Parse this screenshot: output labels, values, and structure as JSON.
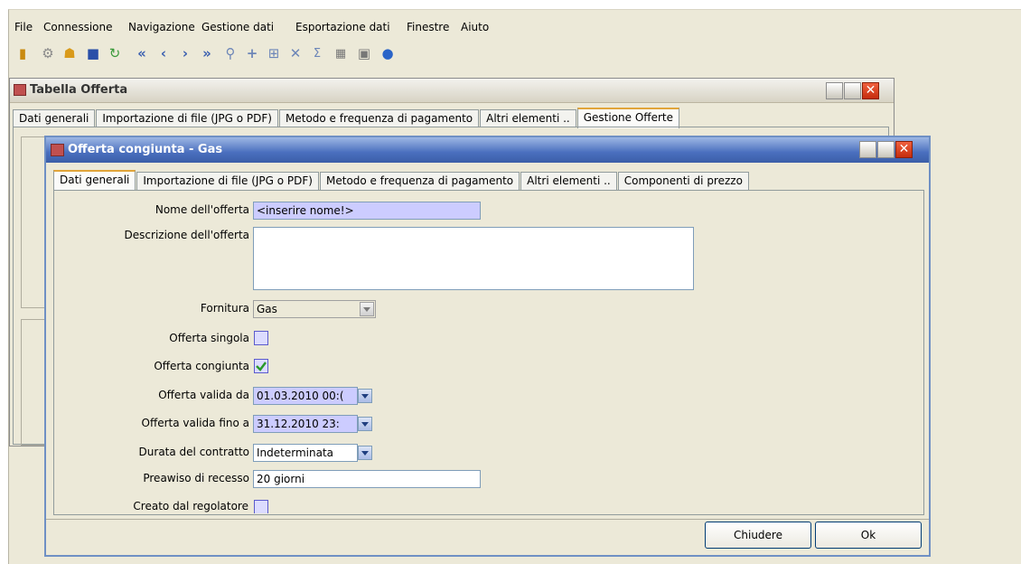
{
  "menu": [
    "File",
    "Connessione",
    "Navigazione",
    "Gestione dati",
    "Esportazione dati",
    "Finestre",
    "Aiuto"
  ],
  "toolbar": {
    "icons": [
      "exit-icon",
      "connect-icon",
      "user-key-icon",
      "save-icon",
      "refresh-icon",
      "first-record-icon",
      "previous-record-icon",
      "next-record-icon",
      "last-record-icon",
      "search-icon",
      "add-icon",
      "tree-icon",
      "delete-icon",
      "sum-icon",
      "calendar-icon",
      "export-icon",
      "help-icon"
    ]
  },
  "back_window": {
    "title": "Tabella Offerta",
    "tabs": [
      "Dati generali",
      "Importazione di file (JPG o PDF)",
      "Metodo e frequenza di pagamento",
      "Altri elementi ..",
      "Gestione Offerte"
    ],
    "active_tab": "Gestione Offerte"
  },
  "front_window": {
    "title": "Offerta congiunta - Gas",
    "tabs": [
      "Dati generali",
      "Importazione di file (JPG o PDF)",
      "Metodo e frequenza di pagamento",
      "Altri elementi ..",
      "Componenti di prezzo"
    ],
    "active_tab": "Dati generali"
  },
  "form": {
    "nome_label": "Nome dell'offerta",
    "nome_value": "<inserire nome!>",
    "descrizione_label": "Descrizione dell'offerta",
    "descrizione_value": "",
    "fornitura_label": "Fornitura",
    "fornitura_value": "Gas",
    "singola_label": "Offerta singola",
    "singola_checked": false,
    "congiunta_label": "Offerta congiunta",
    "congiunta_checked": true,
    "valida_da_label": "Offerta valida da",
    "valida_da_value": "01.03.2010 00:(",
    "valida_a_label": "Offerta valida fino a",
    "valida_a_value": "31.12.2010 23:",
    "durata_label": "Durata del contratto",
    "durata_value": "Indeterminata",
    "preavviso_label": "Preawiso di recesso",
    "preavviso_value": "20 giorni",
    "regolatore_label": "Creato dal regolatore",
    "regolatore_checked": false
  },
  "buttons": {
    "close": "Chiudere",
    "ok": "Ok"
  },
  "colors": {
    "title_active": "#3b5ea8",
    "field_highlight": "#ccccff",
    "check_green": "#2a9a2a"
  }
}
